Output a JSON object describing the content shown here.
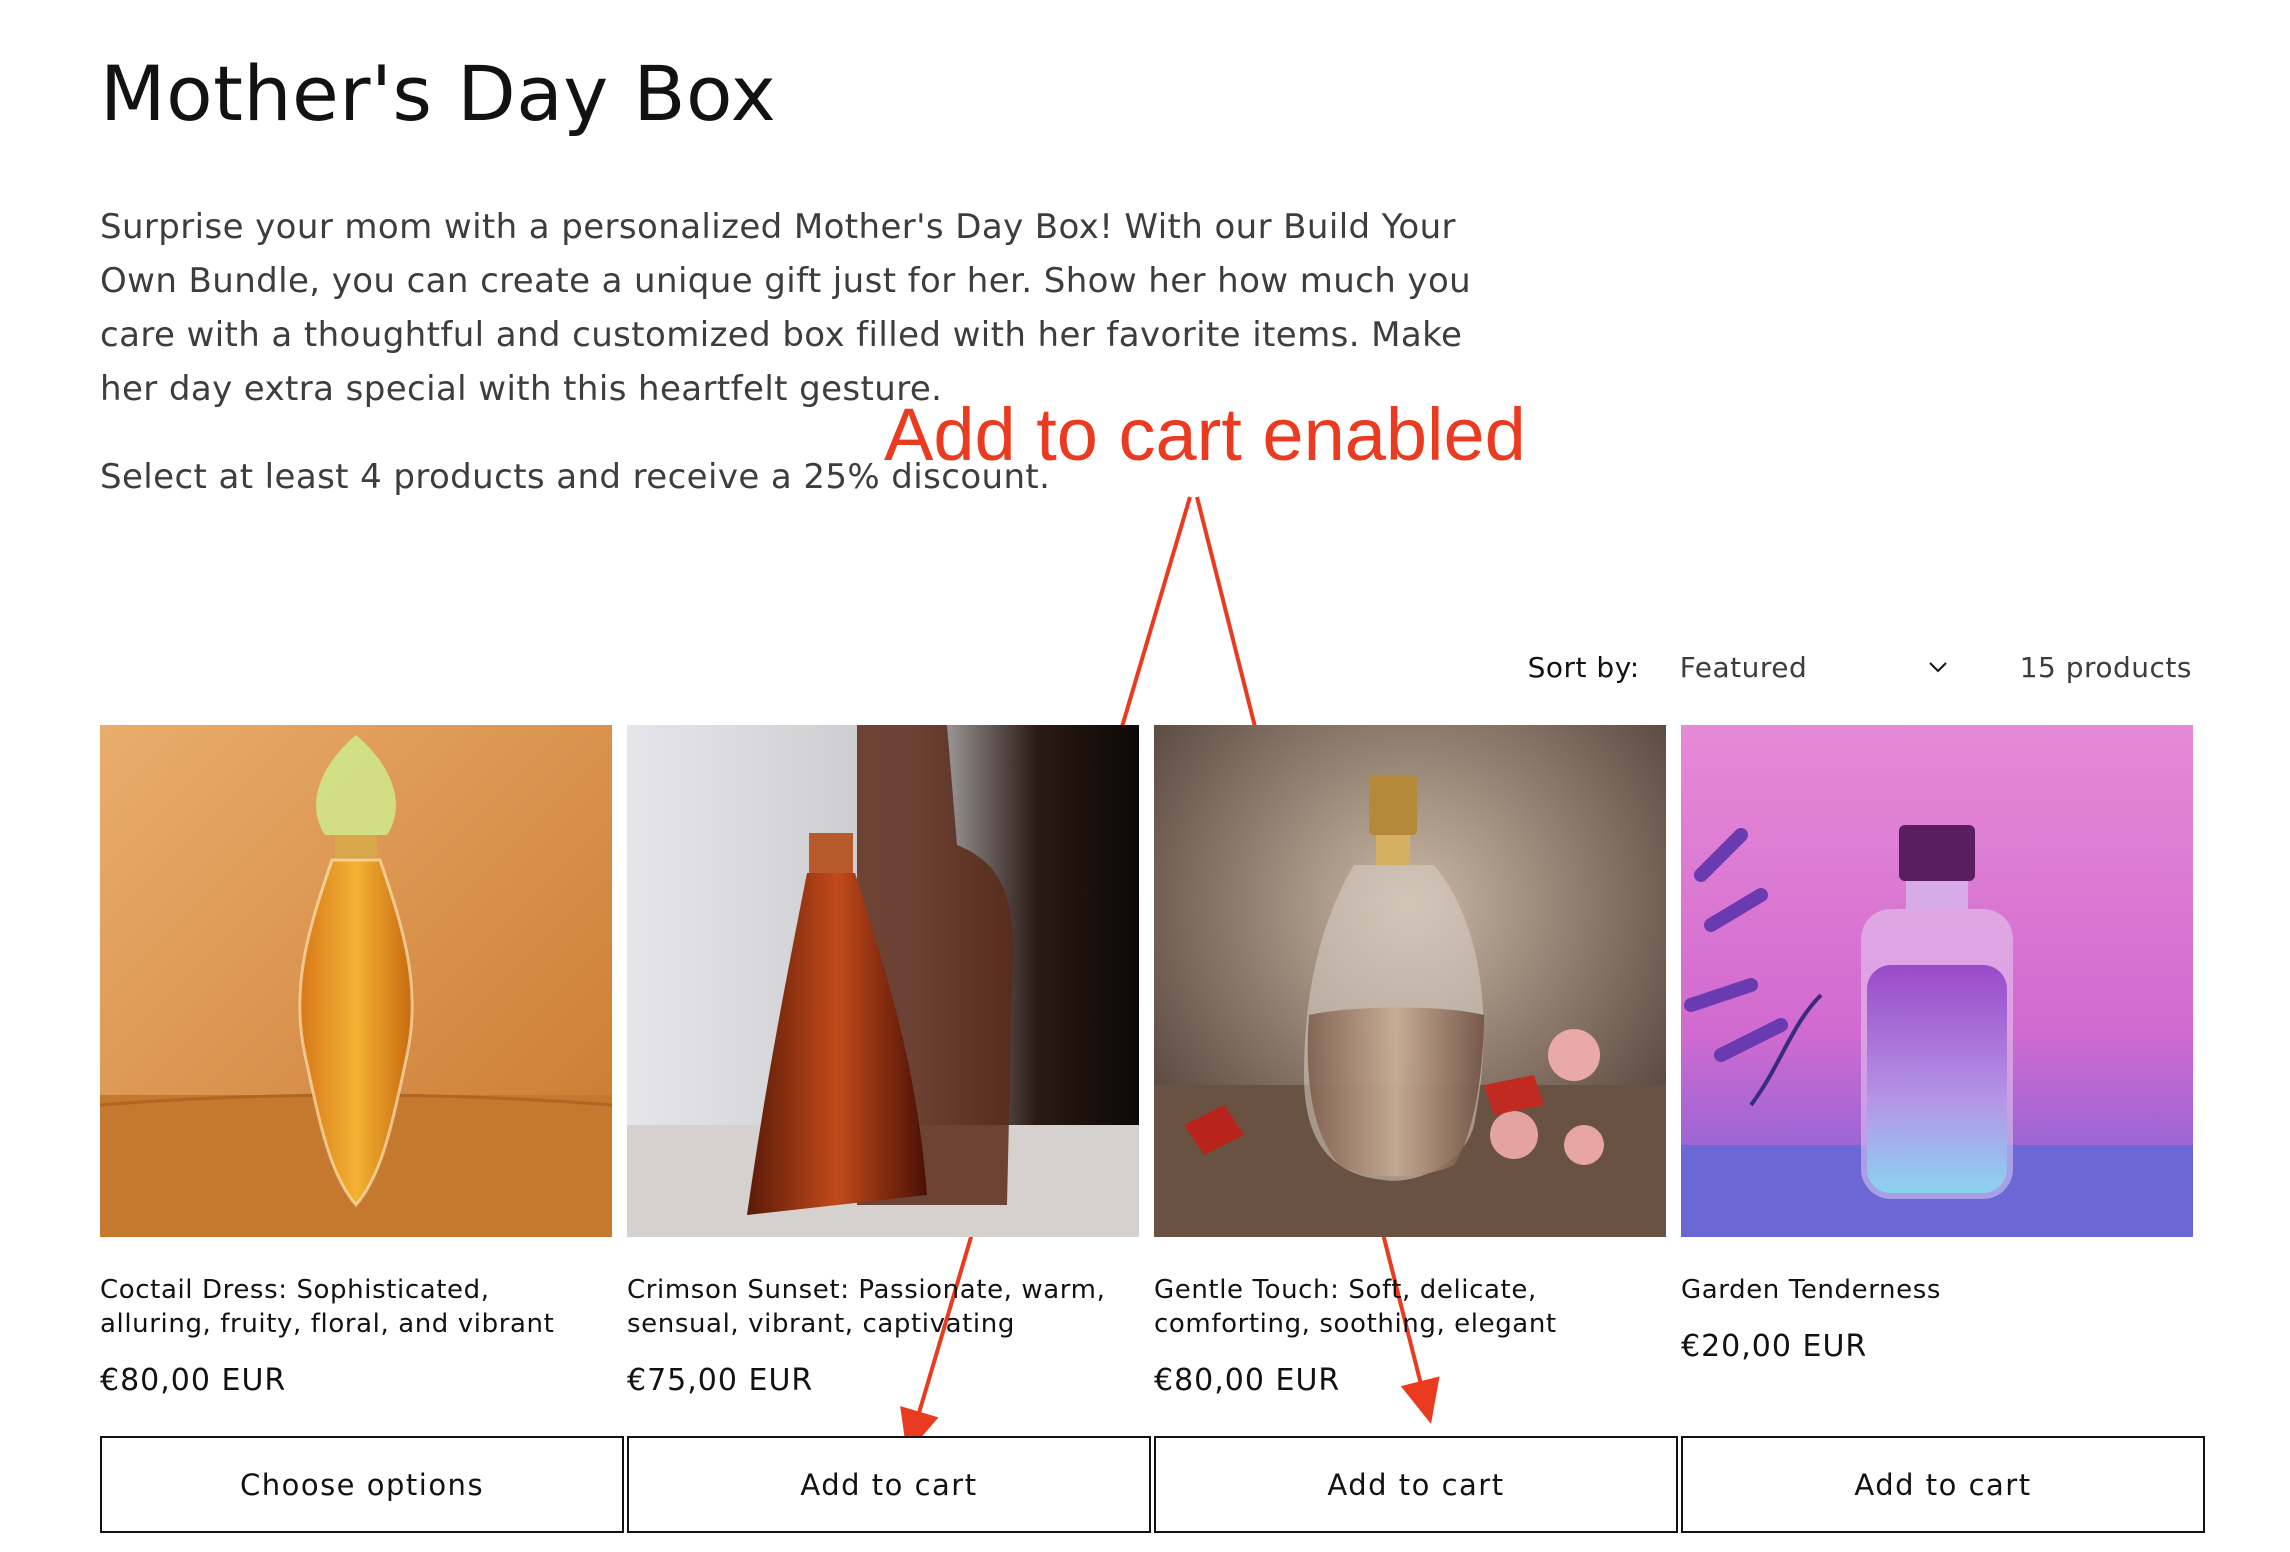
{
  "page": {
    "title": "Mother's Day Box",
    "description": "Surprise your mom with a personalized Mother's Day Box! With our Build Your Own Bundle, you can create a unique gift just for her. Show her how much you care with a thoughtful and customized box filled with her favorite items. Make her day extra special with this heartfelt gesture.",
    "discount_note": "Select at least 4 products and receive a 25% discount."
  },
  "annotation": {
    "label": "Add to cart enabled",
    "color": "#ea3a1f"
  },
  "toolbar": {
    "sort_label": "Sort by:",
    "sort_value": "Featured",
    "product_count": "15 products"
  },
  "products": [
    {
      "title": "Coctail Dress: Sophisticated, alluring, fruity, floral, and vibrant",
      "price": "€80,00 EUR",
      "button": "Choose options",
      "image_icon": "amber-perfume-bottle"
    },
    {
      "title": "Crimson Sunset: Passionate, warm, sensual, vibrant, captivating",
      "price": "€75,00 EUR",
      "button": "Add to cart",
      "image_icon": "red-glass-bottle"
    },
    {
      "title": "Gentle Touch: Soft, delicate, comforting, soothing, elegant",
      "price": "€80,00 EUR",
      "button": "Add to cart",
      "image_icon": "clear-perfume-bottle"
    },
    {
      "title": "Garden Tenderness",
      "price": "€20,00 EUR",
      "button": "Add to cart",
      "image_icon": "purple-lavender-bottle"
    }
  ]
}
